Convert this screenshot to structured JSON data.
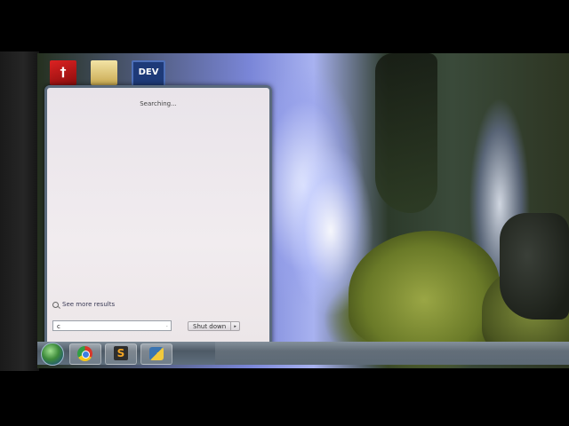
{
  "start_menu": {
    "status_text": "Searching...",
    "see_more_label": "See more results",
    "search_value": "c",
    "search_clear": "·",
    "shutdown_label": "Shut down",
    "shutdown_arrow": "▸"
  },
  "desktop_icons": {
    "acrobat_glyph": "†",
    "dev_label": "DEV"
  },
  "taskbar": {
    "sublime_glyph": "S"
  }
}
